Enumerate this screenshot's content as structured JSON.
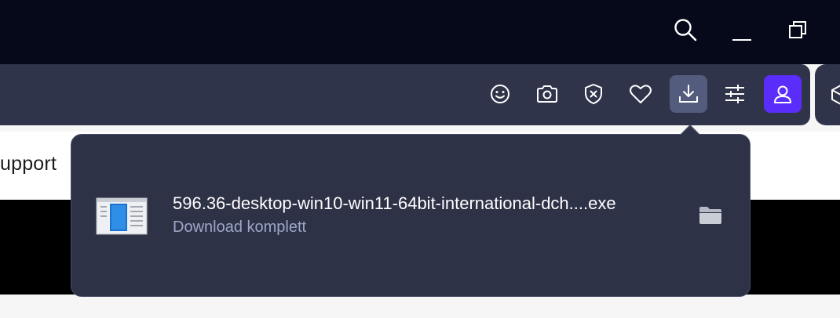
{
  "titlebar": {
    "buttons": [
      {
        "name": "search-button",
        "icon": "search-icon"
      },
      {
        "name": "minimize-button",
        "icon": "minimize-icon"
      },
      {
        "name": "restore-button",
        "icon": "restore-icon"
      }
    ]
  },
  "toolbar": {
    "buttons": [
      {
        "name": "emoji-button",
        "icon": "smiley-icon"
      },
      {
        "name": "screenshot-button",
        "icon": "camera-icon"
      },
      {
        "name": "ad-blocker-button",
        "icon": "shield-x-icon"
      },
      {
        "name": "favorites-button",
        "icon": "heart-icon"
      },
      {
        "name": "downloads-button",
        "icon": "download-icon",
        "active": true
      },
      {
        "name": "easy-setup-button",
        "icon": "sliders-icon"
      },
      {
        "name": "profile-button",
        "icon": "user-icon"
      }
    ],
    "colors": {
      "toolbar": "#30344a",
      "active": "#545c7e",
      "profile": "#5b2dfa"
    }
  },
  "page": {
    "partial_text": "upport"
  },
  "download_popup": {
    "filename": "596.36-desktop-win10-win11-64bit-international-dch....exe",
    "status": "Download komplett",
    "folder_icon": "folder-icon",
    "file_icon": "installer-icon"
  }
}
